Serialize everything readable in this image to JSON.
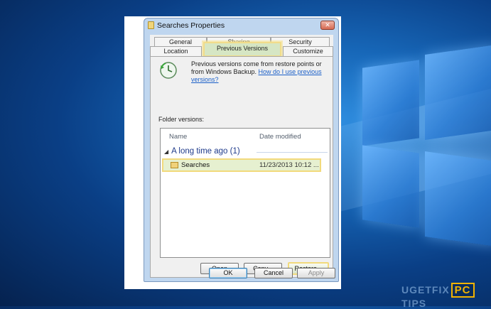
{
  "dialog": {
    "title": "Searches Properties",
    "close_symbol": "✕",
    "tabs": [
      {
        "label": "General",
        "row": 1
      },
      {
        "label": "Sharing",
        "row": 1
      },
      {
        "label": "Security",
        "row": 1
      },
      {
        "label": "Location",
        "row": 2
      },
      {
        "label": "Previous Versions",
        "row": 2,
        "active": true
      },
      {
        "label": "Customize",
        "row": 2
      }
    ],
    "description": "Previous versions come from restore points or from Windows Backup.",
    "help_link": "How do I use previous versions?",
    "folder_versions_label": "Folder versions:",
    "columns": [
      "Name",
      "Date modified"
    ],
    "group_label": "A long time ago (1)",
    "items": [
      {
        "name": "Searches",
        "date_modified": "11/23/2013 10:12 ...",
        "icon": "folder-icon"
      }
    ],
    "buttons": {
      "open": "Open",
      "copy": "Copy...",
      "restore": "Restore...",
      "ok": "OK",
      "cancel": "Cancel",
      "apply": "Apply"
    }
  },
  "watermark": {
    "left": "UGETFIX",
    "box": "PC",
    "right": "TIPS"
  },
  "colors": {
    "highlight": "#f2da7c",
    "link": "#1a5fc8",
    "desktop": "#0a3f86"
  }
}
